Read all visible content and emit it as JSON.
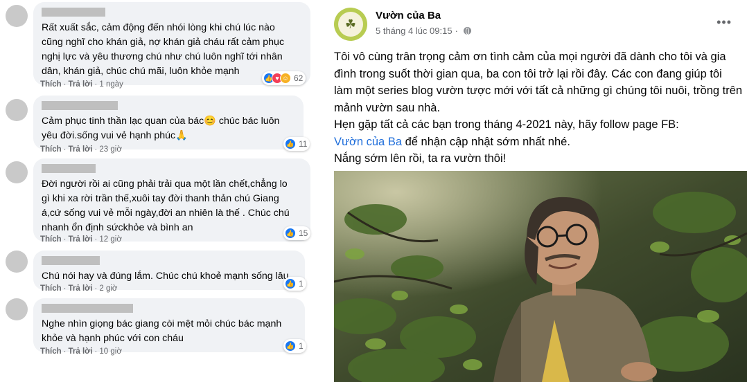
{
  "comments": [
    {
      "text": "Rất xuất sắc, cảm động đến nhói lòng khi chú lúc nào\ncũng nghĩ cho khán giả, nợ khán giả cháu rất cảm phục\nnghị lực và yêu thương chú như chú luôn nghĩ tới nhân\ndân, khán giả, chúc chú mãi, luôn khỏe mạnh",
      "like_label": "Thích",
      "reply_label": "Trả lời",
      "time": "1 ngày",
      "reaction_count": "62",
      "reactions": [
        "like-icon",
        "love-icon",
        "haha-icon"
      ]
    },
    {
      "text": "Cảm phục tinh thần lạc quan của bác😊 chúc bác luôn\nyêu đời.sống vui vẻ hạnh phúc🙏",
      "like_label": "Thích",
      "reply_label": "Trả lời",
      "time": "23 giờ",
      "reaction_count": "11",
      "reactions": [
        "like-icon"
      ]
    },
    {
      "text": "Đời người rồi ai cũng phải trải qua một lần chết,chẳng lo\ngì khi xa rời trần thế,xuôi tay đời thanh thản chú Giang\ná,cứ sống vui vẻ mỗi ngày,đời an nhiên là thế . Chúc chú\nnhanh ổn định sứckhỏe và bình an",
      "like_label": "Thích",
      "reply_label": "Trả lời",
      "time": "12 giờ",
      "reaction_count": "15",
      "reactions": [
        "like-icon"
      ]
    },
    {
      "text": "Chú nói hay và đúng lắm. Chúc chú khoẻ mạnh sống lâu",
      "like_label": "Thích",
      "reply_label": "Trả lời",
      "time": "2 giờ",
      "reaction_count": "1",
      "reactions": [
        "like-icon"
      ]
    },
    {
      "text": "Nghe nhìn giọng bác giang còi mệt mỏi chúc bác mạnh\nkhỏe và hạnh phúc với con cháu",
      "like_label": "Thích",
      "reply_label": "Trả lời",
      "time": "10 giờ",
      "reaction_count": "1",
      "reactions": [
        "like-icon"
      ]
    }
  ],
  "post": {
    "page_name": "Vườn của Ba",
    "date": "5 tháng 4 lúc 09:15",
    "separator": "·",
    "more_icon": "more-options-icon",
    "body_line_1": "Tôi vô cùng trân trọng cảm ơn tình cảm của mọi người đã dành cho tôi và gia đình trong suốt thời gian qua, ba con tôi trở lại rồi đây. Các con đang giúp tôi làm một series blog vườn tược mới với tất cả những gì chúng tôi nuôi, trồng trên mảnh vườn sau nhà.",
    "body_line_2": "Hẹn gặp tất cả các bạn trong tháng 4-2021 này, hãy follow page FB:",
    "body_link": "Vườn của Ba",
    "body_line_2_end": " để nhận cập nhật sớm nhất nhé.",
    "body_line_3": "Nắng sớm lên rồi, ta ra vườn thôi!"
  },
  "colors": {
    "bubble_bg": "#f0f2f5",
    "link": "#216fdb",
    "like": "#1877f2",
    "love": "#f33e58",
    "haha": "#f7b125",
    "muted_text": "#65676b"
  }
}
